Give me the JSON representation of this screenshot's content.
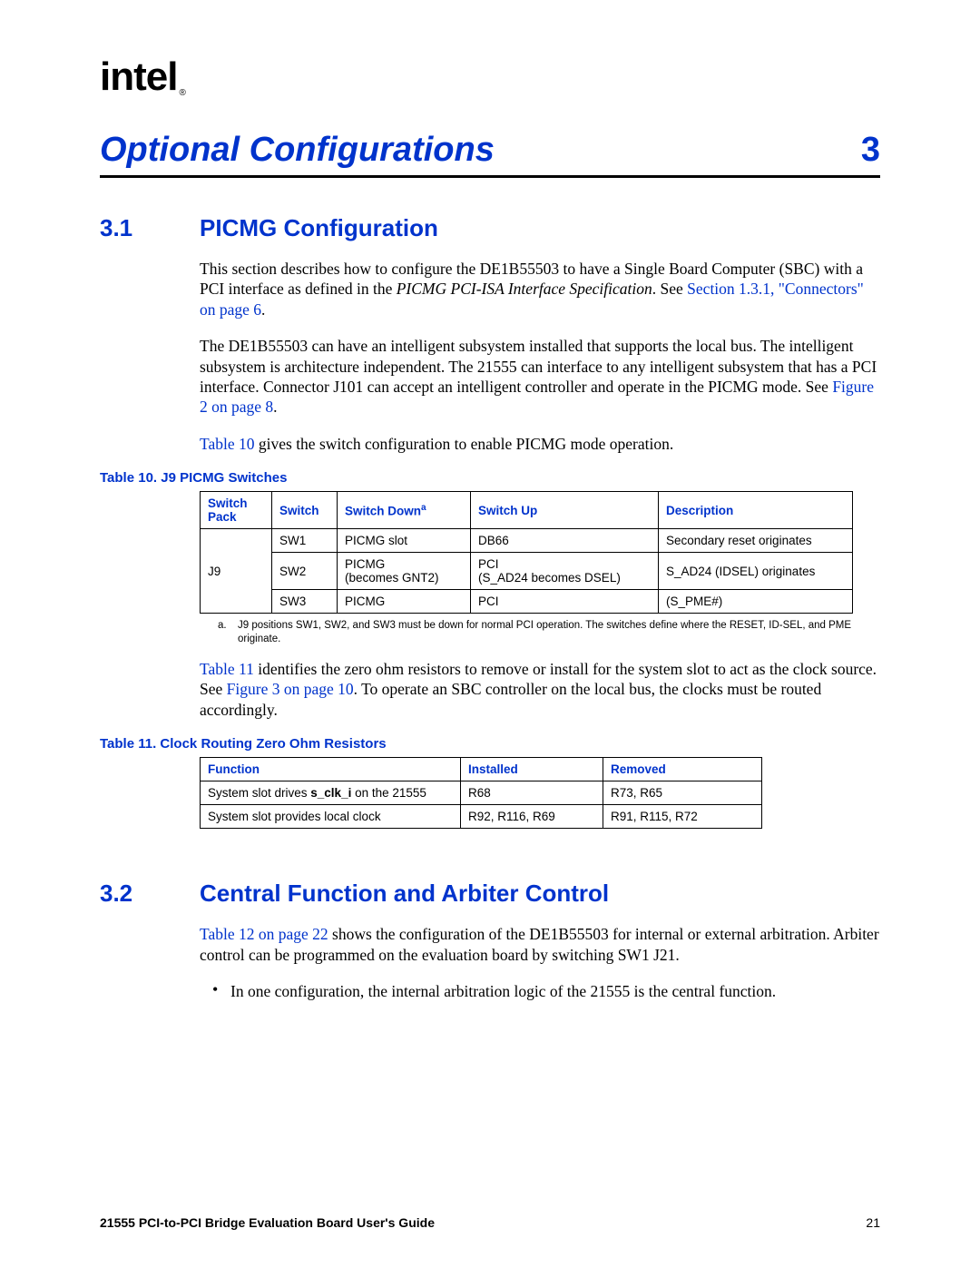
{
  "logo_text": "intel",
  "logo_reg": "®",
  "chapter": {
    "title": "Optional Configurations",
    "number": "3"
  },
  "sections": {
    "s31": {
      "num": "3.1",
      "title": "PICMG Configuration"
    },
    "s32": {
      "num": "3.2",
      "title": "Central Function and Arbiter Control"
    }
  },
  "p1a": "This section describes how to configure the DE1B55503 to have a Single Board Computer (SBC) with a PCI interface as defined in the ",
  "p1b": "PICMG PCI-ISA Interface Specification",
  "p1c": ". See ",
  "p1_link": "Section 1.3.1, \"Connectors\" on page 6",
  "p1d": ".",
  "p2a": "The DE1B55503 can have an intelligent subsystem installed that supports the local bus. The intelligent subsystem is architecture independent. The 21555 can interface to any intelligent subsystem that has a PCI interface. Connector J101 can accept an intelligent controller and operate in the PICMG mode. See ",
  "p2_link": "Figure 2 on page 8",
  "p2b": ".",
  "p3_link": "Table 10",
  "p3a": " gives the switch configuration to enable PICMG mode operation.",
  "table10": {
    "caption": "Table 10. J9 PICMG Switches",
    "headers": {
      "h1": "Switch Pack",
      "h2": "Switch",
      "h3": "Switch Down",
      "h3sup": "a",
      "h4": "Switch Up",
      "h5": "Description"
    },
    "pack": "J9",
    "rows": [
      {
        "sw": "SW1",
        "down": "PICMG slot",
        "up": "DB66",
        "desc": "Secondary reset originates"
      },
      {
        "sw": "SW2",
        "down1": "PICMG",
        "down2": "(becomes GNT2)",
        "up1": "PCI",
        "up2": "(S_AD24 becomes DSEL)",
        "desc": "S_AD24 (IDSEL) originates"
      },
      {
        "sw": "SW3",
        "down": "PICMG",
        "up": "PCI",
        "desc": "(S_PME#)"
      }
    ],
    "footnote_a": "a.",
    "footnote": "J9 positions SW1, SW2, and SW3 must be down for normal PCI operation. The switches define where the RESET, ID-SEL, and PME originate."
  },
  "p4_link1": "Table 11",
  "p4a": " identifies the zero ohm resistors to remove or install for the system slot to act as the clock source. See ",
  "p4_link2": "Figure 3 on page 10",
  "p4b": ". To operate an SBC controller on the local bus, the clocks must be routed accordingly.",
  "table11": {
    "caption": "Table 11. Clock Routing Zero Ohm Resistors",
    "headers": {
      "h1": "Function",
      "h2": "Installed",
      "h3": "Removed"
    },
    "rows": [
      {
        "fn1": "System slot drives ",
        "fn_bold": "s_clk_i",
        "fn2": " on the 21555",
        "inst": "R68",
        "rem": "R73, R65"
      },
      {
        "fn": "System slot provides local clock",
        "inst": "R92, R116, R69",
        "rem": "R91, R115, R72"
      }
    ]
  },
  "p5_link": "Table 12 on page 22",
  "p5a": " shows the configuration of the DE1B55503 for internal or external arbitration. Arbiter control can be programmed on the evaluation board by switching SW1 J21.",
  "bullet1": "In one configuration, the internal arbitration logic of the 21555 is the central function.",
  "footer": {
    "left": "21555 PCI-to-PCI Bridge Evaluation Board User's Guide",
    "right": "21"
  }
}
